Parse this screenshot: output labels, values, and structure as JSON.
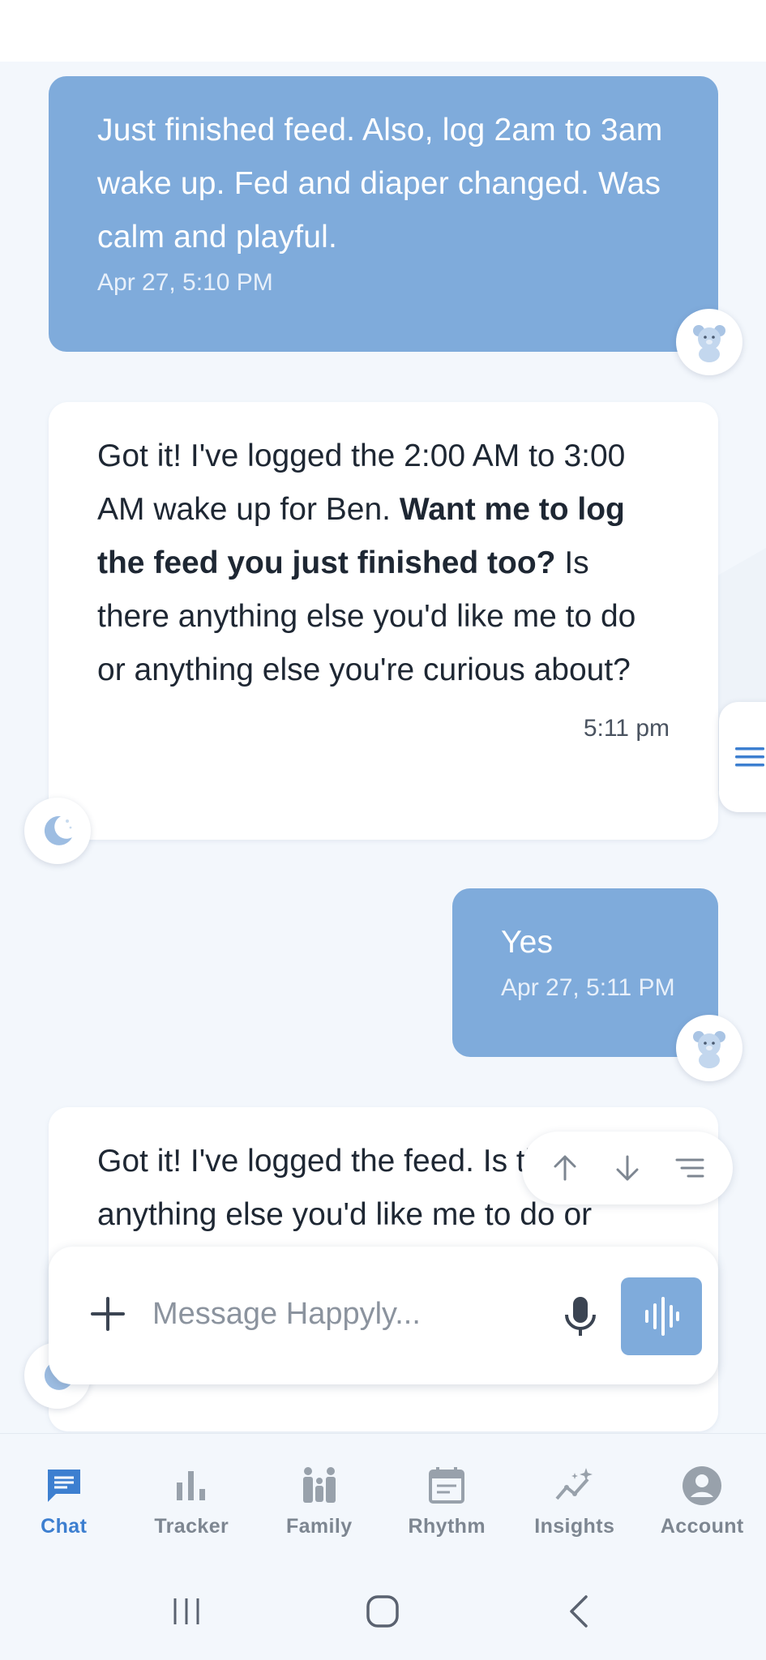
{
  "messages": [
    {
      "role": "user",
      "text": "Just finished feed. Also, log 2am to 3am wake up. Fed and diaper changed. Was calm and playful.",
      "time": "Apr 27, 5:10 PM"
    },
    {
      "role": "bot",
      "text_a": "Got it! I've logged the 2:00 AM to 3:00 AM wake up for Ben. ",
      "text_bold": "Want me to log the feed you just finished too?",
      "text_b": " Is there anything else you'd like me to do or anything else you're curious about?",
      "time": "5:11 pm"
    },
    {
      "role": "user",
      "text": "Yes",
      "time": "Apr 27, 5:11 PM"
    },
    {
      "role": "bot",
      "text": "Got it! I've logged the feed. Is there anything else you'd like me to do or"
    }
  ],
  "composer": {
    "placeholder": "Message Happyly..."
  },
  "nav": [
    {
      "label": "Chat",
      "icon": "chat-icon",
      "active": true
    },
    {
      "label": "Tracker",
      "icon": "bar-chart-icon"
    },
    {
      "label": "Family",
      "icon": "family-icon"
    },
    {
      "label": "Rhythm",
      "icon": "calendar-icon"
    },
    {
      "label": "Insights",
      "icon": "insights-icon"
    },
    {
      "label": "Account",
      "icon": "account-icon"
    }
  ],
  "colors": {
    "accent": "#3d7fd0",
    "user_bubble": "#7fabdb",
    "background": "#f3f7fc"
  }
}
